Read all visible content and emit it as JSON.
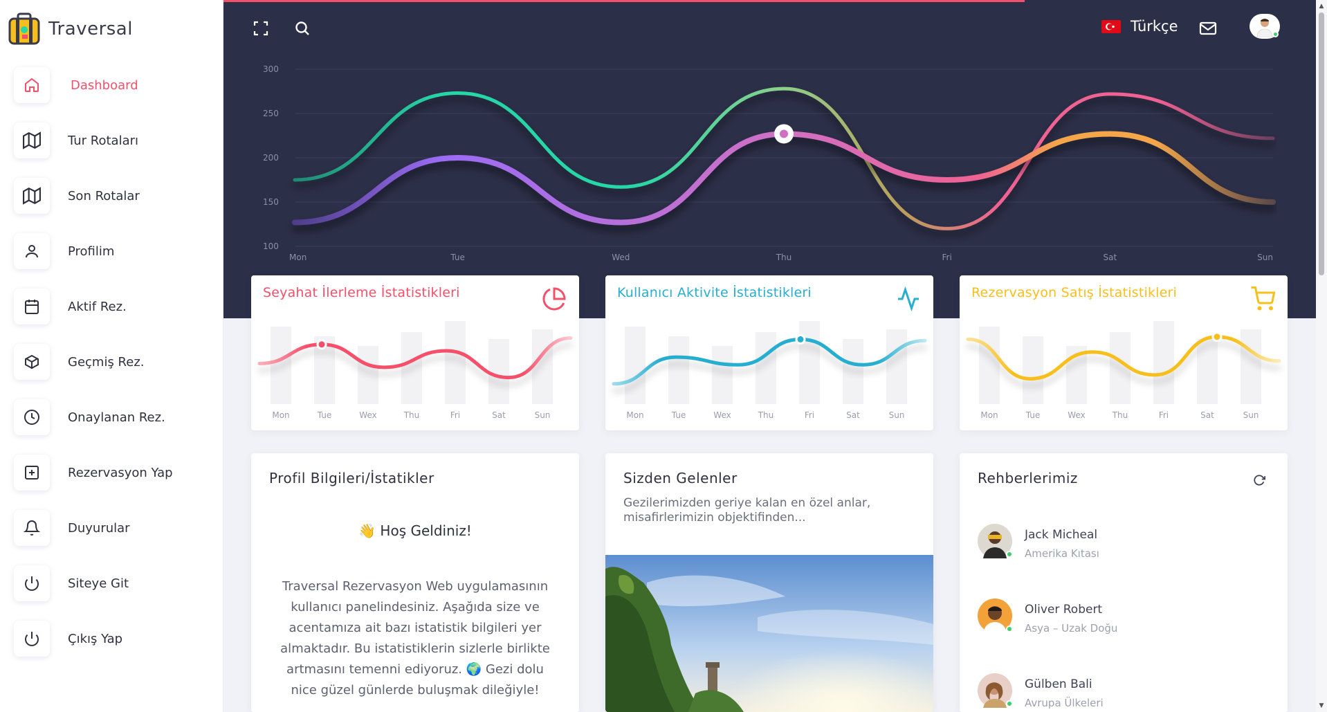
{
  "app": {
    "title": "Traversal"
  },
  "sidebar": {
    "items": [
      {
        "label": "Dashboard",
        "icon": "home-icon",
        "active": true
      },
      {
        "label": "Tur Rotaları",
        "icon": "map-icon"
      },
      {
        "label": "Son Rotalar",
        "icon": "map-icon"
      },
      {
        "label": "Profilim",
        "icon": "user-icon"
      },
      {
        "label": "Aktif Rez.",
        "icon": "calendar-icon"
      },
      {
        "label": "Geçmiş Rez.",
        "icon": "box-icon"
      },
      {
        "label": "Onaylanan Rez.",
        "icon": "clock-icon"
      },
      {
        "label": "Rezervasyon Yap",
        "icon": "plus-square-icon"
      },
      {
        "label": "Duyurular",
        "icon": "bell-icon"
      },
      {
        "label": "Siteye Git",
        "icon": "power-icon"
      },
      {
        "label": "Çıkış Yap",
        "icon": "power-icon"
      }
    ]
  },
  "header": {
    "language": "Türkçe",
    "icons": [
      "fullscreen-icon",
      "search-icon",
      "mail-icon"
    ]
  },
  "colors": {
    "accent": "#f5506a",
    "header_bg": "#2c2f48",
    "teal": "#27d6a6",
    "purple": "#9b6cf5",
    "cyan": "#27aed0",
    "yellow": "#f7bf1c"
  },
  "stat_cards": [
    {
      "title": "Seyahat İlerleme İstatistikleri",
      "color": "#f5506a",
      "icon": "pie-chart-icon"
    },
    {
      "title": "Kullanıcı Aktivite İstatistikleri",
      "color": "#27aed0",
      "icon": "activity-icon"
    },
    {
      "title": "Rezervasyon Satış İstatistikleri",
      "color": "#f7bf1c",
      "icon": "cart-icon"
    }
  ],
  "profile_card": {
    "title": "Profil Bilgileri/İstatikler",
    "welcome": "👋 Hoş Geldiniz!",
    "description": "Traversal Rezervasyon Web uygulamasının kullanıcı panelindesiniz. Aşağıda size ve acentamıza ait bazı istatistik bilgileri yer almaktadır. Bu istatistiklerin sizlerle birlikte artmasını temenni ediyoruz. 🌍 Gezi dolu nice güzel günlerde buluşmak dileğiyle!"
  },
  "gallery_card": {
    "title": "Sizden Gelenler",
    "description": "Gezilerimizden geriye kalan en özel anlar, misafirlerimizin objektifinden..."
  },
  "guides_card": {
    "title": "Rehberlerimiz",
    "guides": [
      {
        "name": "Jack Micheal",
        "region": "Amerika Kıtası"
      },
      {
        "name": "Oliver Robert",
        "region": "Asya – Uzak Doğu"
      },
      {
        "name": "Gülben Bali",
        "region": "Avrupa Ülkeleri"
      }
    ]
  },
  "chart_data": [
    {
      "type": "line",
      "categories": [
        "Mon",
        "Tue",
        "Wed",
        "Thu",
        "Fri",
        "Sat",
        "Sun"
      ],
      "ylim": [
        100,
        300
      ],
      "yticks": [
        300,
        250,
        200,
        150,
        100
      ],
      "grid": true,
      "series": [
        {
          "values": [
            175,
            273,
            167,
            278,
            120,
            272,
            222
          ],
          "color": "#27d6a6"
        },
        {
          "values": [
            127,
            200,
            127,
            227,
            175,
            227,
            150
          ],
          "color": "#9b6cf5"
        }
      ]
    },
    {
      "type": "line",
      "categories": [
        "Mon",
        "Tue",
        "Wex",
        "Thu",
        "Fri",
        "Sat",
        "Sun"
      ],
      "series": [
        {
          "values": [
            0.42,
            0.72,
            0.36,
            0.62,
            0.2,
            0.82
          ],
          "color": "#f5506a"
        }
      ]
    },
    {
      "type": "line",
      "categories": [
        "Mon",
        "Tue",
        "Wex",
        "Thu",
        "Fri",
        "Sat",
        "Sun"
      ],
      "series": [
        {
          "values": [
            0.1,
            0.52,
            0.4,
            0.8,
            0.4,
            0.78
          ],
          "color": "#27aed0"
        }
      ]
    },
    {
      "type": "line",
      "categories": [
        "Mon",
        "Tue",
        "Wex",
        "Thu",
        "Fri",
        "Sat",
        "Sun"
      ],
      "series": [
        {
          "values": [
            0.8,
            0.18,
            0.6,
            0.24,
            0.84,
            0.46
          ],
          "color": "#f7bf1c"
        }
      ]
    }
  ]
}
